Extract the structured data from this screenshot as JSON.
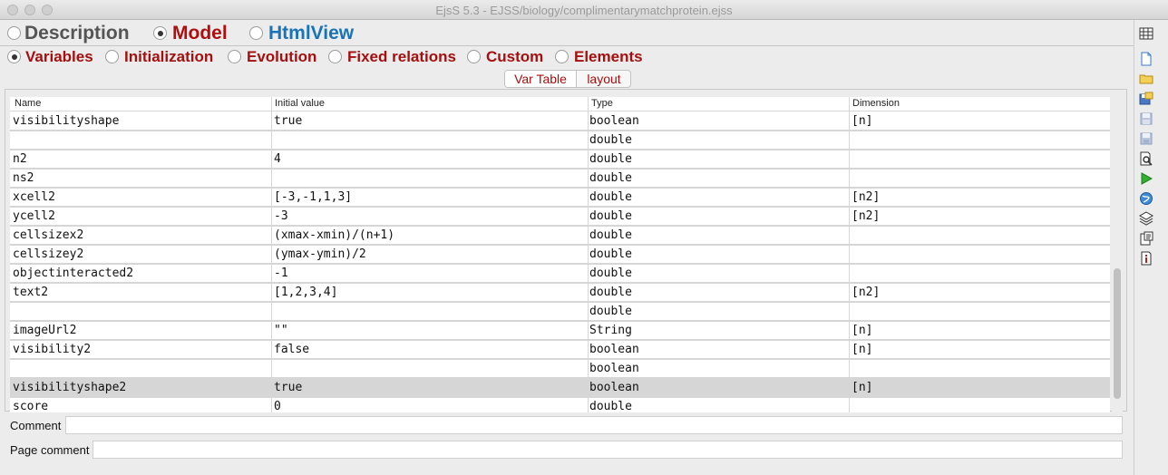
{
  "window": {
    "title": "EjsS 5.3 - EJSS/biology/complimentarymatchprotein.ejss"
  },
  "main_tabs": [
    {
      "label": "Description",
      "selected": false,
      "color": "#555555"
    },
    {
      "label": "Model",
      "selected": true,
      "color": "#b00e0e"
    },
    {
      "label": "HtmlView",
      "selected": false,
      "color": "#1a72b8"
    }
  ],
  "model_tabs": [
    {
      "label": "Variables",
      "selected": true
    },
    {
      "label": "Initialization",
      "selected": false
    },
    {
      "label": "Evolution",
      "selected": false
    },
    {
      "label": "Fixed relations",
      "selected": false
    },
    {
      "label": "Custom",
      "selected": false
    },
    {
      "label": "Elements",
      "selected": false
    }
  ],
  "view_toggle": {
    "var_table_label": "Var Table",
    "layout_label": "layout",
    "selected": "Var Table"
  },
  "table": {
    "headers": [
      "Name",
      "Initial value",
      "Type",
      "Dimension"
    ],
    "rows": [
      {
        "name": "visibilityshape",
        "init": "true",
        "type": "boolean",
        "dim": "[n]",
        "selected": false
      },
      {
        "name": "",
        "init": "",
        "type": "double",
        "dim": "",
        "selected": false
      },
      {
        "name": "n2",
        "init": "4",
        "type": "double",
        "dim": "",
        "selected": false
      },
      {
        "name": "ns2",
        "init": "",
        "type": "double",
        "dim": "",
        "selected": false
      },
      {
        "name": "xcell2",
        "init": "[-3,-1,1,3]",
        "type": "double",
        "dim": "[n2]",
        "selected": false
      },
      {
        "name": "ycell2",
        "init": "-3",
        "type": "double",
        "dim": "[n2]",
        "selected": false
      },
      {
        "name": "cellsizex2",
        "init": "(xmax-xmin)/(n+1)",
        "type": "double",
        "dim": "",
        "selected": false
      },
      {
        "name": "cellsizey2",
        "init": "(ymax-ymin)/2",
        "type": "double",
        "dim": "",
        "selected": false
      },
      {
        "name": "objectinteracted2",
        "init": "-1",
        "type": "double",
        "dim": "",
        "selected": false
      },
      {
        "name": "text2",
        "init": "[1,2,3,4]",
        "type": "double",
        "dim": "[n2]",
        "selected": false
      },
      {
        "name": "",
        "init": "",
        "type": "double",
        "dim": "",
        "selected": false
      },
      {
        "name": "imageUrl2",
        "init": "\"\"",
        "type": "String",
        "dim": "[n]",
        "selected": false
      },
      {
        "name": "visibility2",
        "init": "false",
        "type": "boolean",
        "dim": "[n]",
        "selected": false
      },
      {
        "name": "",
        "init": "",
        "type": "boolean",
        "dim": "",
        "selected": false
      },
      {
        "name": "visibilityshape2",
        "init": "true",
        "type": "boolean",
        "dim": "[n]",
        "selected": true
      },
      {
        "name": "score",
        "init": "0",
        "type": "double",
        "dim": "",
        "selected": false
      }
    ]
  },
  "comment": {
    "label": "Comment",
    "value": ""
  },
  "page_comment": {
    "label": "Page comment",
    "value": ""
  },
  "toolbar_icons": [
    "table-icon",
    "new-file-icon",
    "open-folder-icon",
    "save-icon",
    "save-disabled-icon",
    "save-as-icon",
    "search-document-icon",
    "run-icon",
    "web-globe-icon",
    "layers-icon",
    "clipboard-icon",
    "info-icon"
  ]
}
